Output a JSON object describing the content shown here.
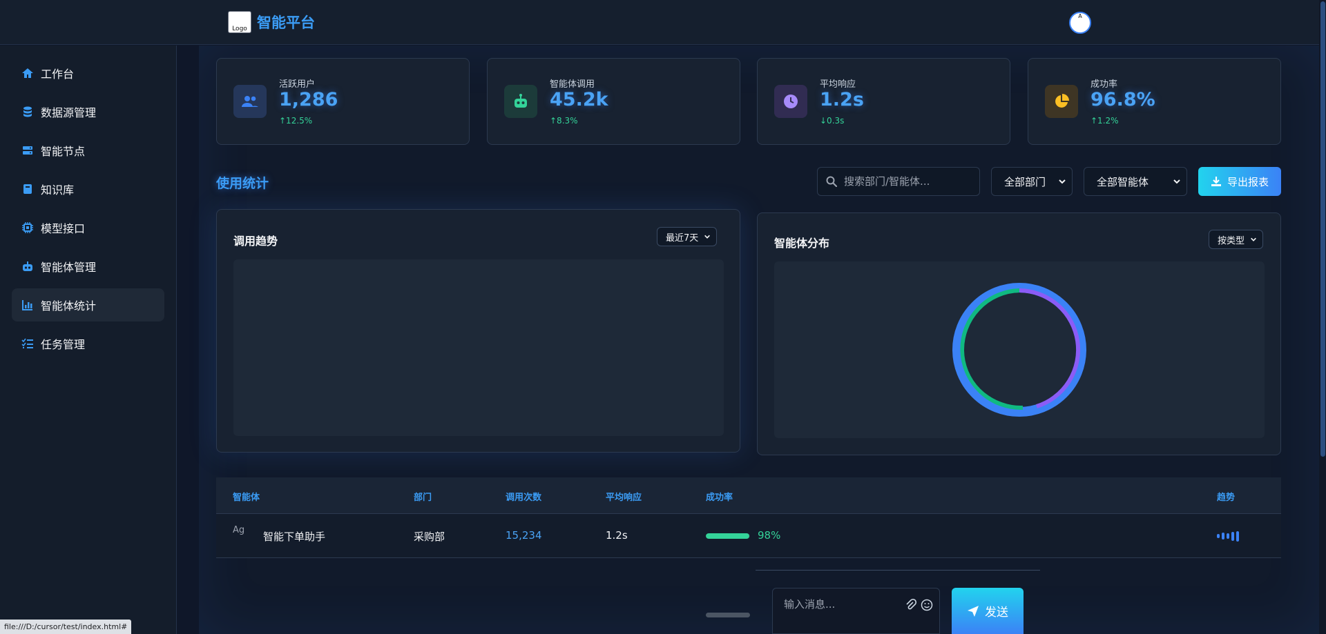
{
  "header": {
    "logo_alt": "Logo",
    "brand": "智能平台",
    "avatar_alt": "A"
  },
  "sidebar": {
    "items": [
      {
        "label": "工作台",
        "icon": "home-icon",
        "active": false
      },
      {
        "label": "数据源管理",
        "icon": "database-icon",
        "active": false
      },
      {
        "label": "智能节点",
        "icon": "server-icon",
        "active": false
      },
      {
        "label": "知识库",
        "icon": "book-icon",
        "active": false
      },
      {
        "label": "模型接口",
        "icon": "chip-icon",
        "active": false
      },
      {
        "label": "智能体管理",
        "icon": "robot-icon",
        "active": false
      },
      {
        "label": "智能体统计",
        "icon": "bar-chart-icon",
        "active": true
      },
      {
        "label": "任务管理",
        "icon": "task-list-icon",
        "active": false
      }
    ]
  },
  "stats": [
    {
      "label": "活跃用户",
      "value": "1,286",
      "change": "↑12.5%",
      "icon": "users-icon",
      "color": "#3b82f6",
      "bg": "#25375a"
    },
    {
      "label": "智能体调用",
      "value": "45.2k",
      "change": "↑8.3%",
      "icon": "robot-icon",
      "color": "#34d399",
      "bg": "#1c3b3a"
    },
    {
      "label": "平均响应",
      "value": "1.2s",
      "change": "↓0.3s",
      "icon": "clock-icon",
      "color": "#a78bfa",
      "bg": "#312c52"
    },
    {
      "label": "成功率",
      "value": "96.8%",
      "change": "↑1.2%",
      "icon": "pie-chart-icon",
      "color": "#fbbf24",
      "bg": "#3e3524"
    }
  ],
  "usage": {
    "title": "使用统计",
    "search_placeholder": "搜索部门/智能体...",
    "department_filter": "全部部门",
    "agent_filter": "全部智能体",
    "export_label": "导出报表"
  },
  "trend_panel": {
    "title": "调用趋势",
    "range": "最近7天"
  },
  "distribution_panel": {
    "title": "智能体分布",
    "group_by": "按类型"
  },
  "table": {
    "headers": [
      "智能体",
      "部门",
      "调用次数",
      "平均响应",
      "成功率",
      "趋势"
    ],
    "rows": [
      {
        "avatar_alt": "Ag",
        "name": "智能下单助手",
        "department": "采购部",
        "calls": "15,234",
        "response": "1.2s",
        "success": "98%",
        "success_fraction": 0.98
      }
    ]
  },
  "chat": {
    "placeholder": "输入消息...",
    "send_label": "发送"
  },
  "status_bar": {
    "url": "file:///D:/cursor/test/index.html#"
  }
}
